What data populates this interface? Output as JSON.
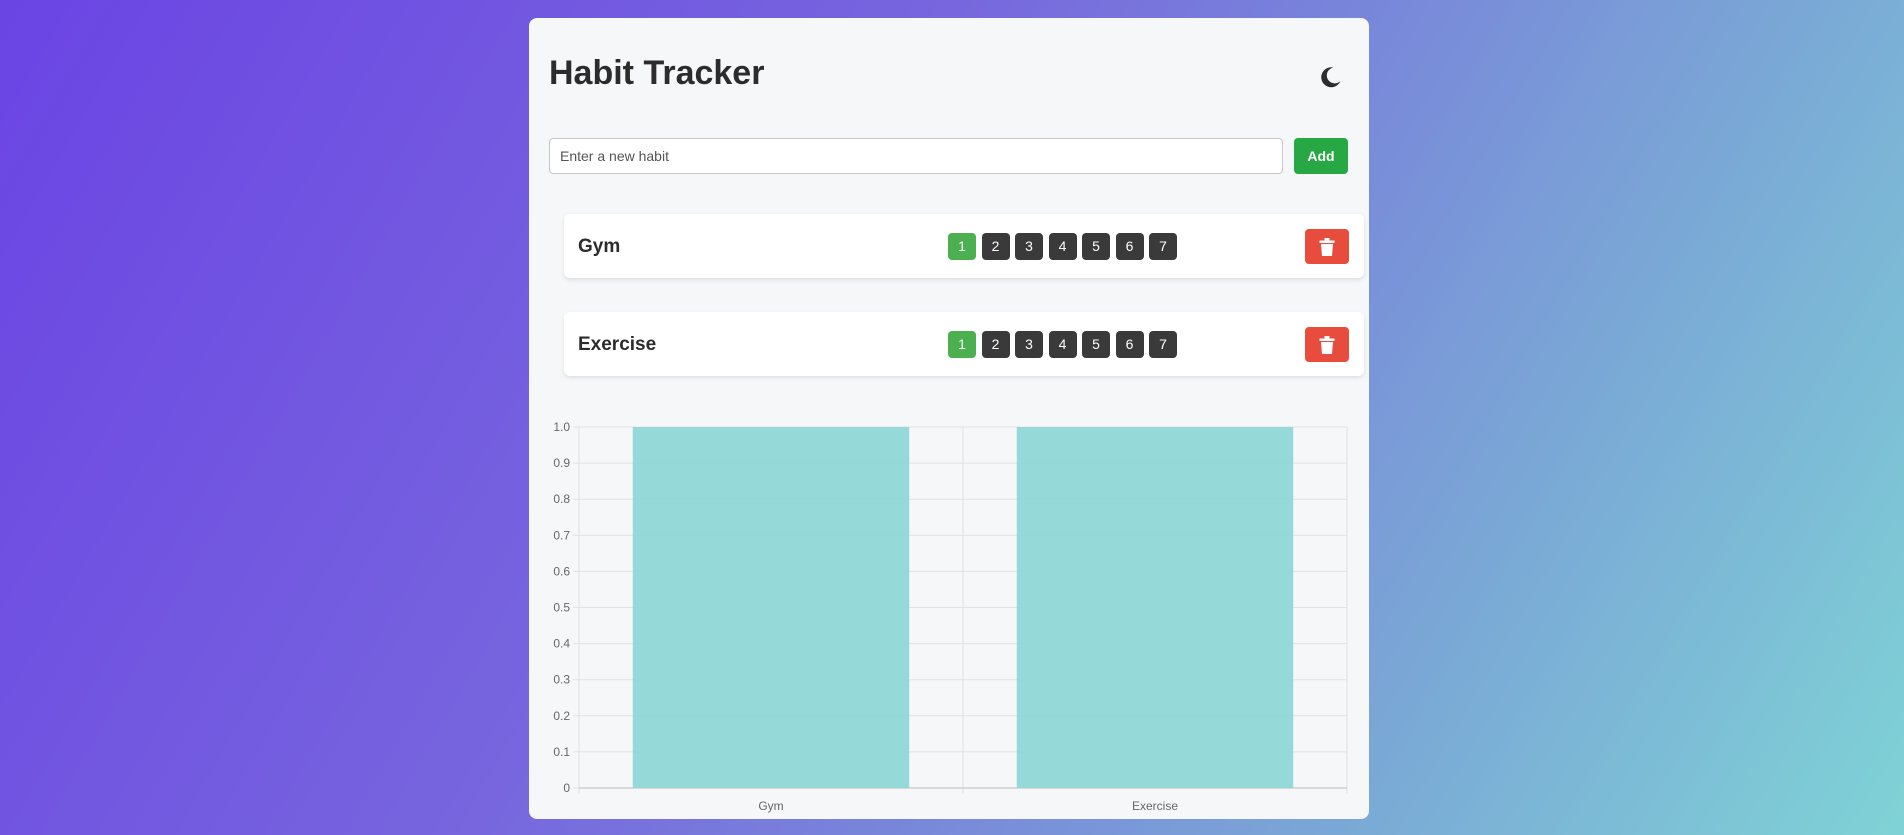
{
  "app": {
    "title": "Habit Tracker",
    "theme_toggle_icon": "moon-icon"
  },
  "add_form": {
    "placeholder": "Enter a new habit",
    "value": "",
    "add_label": "Add"
  },
  "habits": [
    {
      "name": "Gym",
      "days": [
        "1",
        "2",
        "3",
        "4",
        "5",
        "6",
        "7"
      ],
      "completed": [
        true,
        false,
        false,
        false,
        false,
        false,
        false
      ],
      "delete_icon": "trash-icon"
    },
    {
      "name": "Exercise",
      "days": [
        "1",
        "2",
        "3",
        "4",
        "5",
        "6",
        "7"
      ],
      "completed": [
        true,
        false,
        false,
        false,
        false,
        false,
        false
      ],
      "delete_icon": "trash-icon"
    }
  ],
  "colors": {
    "completed_day": "#4caf50",
    "pending_day": "#3a3a3a",
    "add_button": "#28a745",
    "delete_button": "#e74c3c",
    "bar_fill": "#8fd7d6"
  },
  "chart_data": {
    "type": "bar",
    "categories": [
      "Gym",
      "Exercise"
    ],
    "values": [
      1,
      1
    ],
    "ylim": [
      0,
      1
    ],
    "yticks": [
      "0",
      "0.1",
      "0.2",
      "0.3",
      "0.4",
      "0.5",
      "0.6",
      "0.7",
      "0.8",
      "0.9",
      "1.0"
    ],
    "grid": true,
    "title": "",
    "xlabel": "",
    "ylabel": ""
  }
}
